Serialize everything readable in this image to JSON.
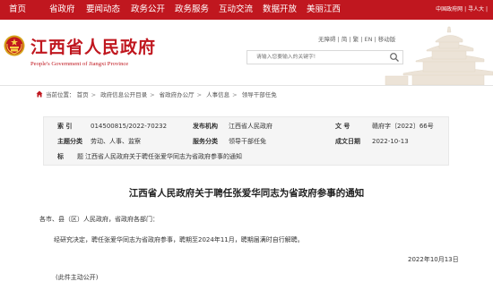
{
  "nav": {
    "items": [
      "首页",
      "省政府",
      "要闻动态",
      "政务公开",
      "政务服务",
      "互动交流",
      "数据开放",
      "美丽江西"
    ],
    "top_links": [
      "中国政府网",
      "|",
      "寻人大",
      "|"
    ]
  },
  "header": {
    "site_title": "江西省人民政府",
    "site_subtitle": "People's Government of Jiangxi Province",
    "util_links": [
      "无障碍",
      "简",
      "繁",
      "EN",
      "移动版"
    ],
    "search_placeholder": "请输入您要输入的关键字!"
  },
  "breadcrumb": [
    "首页",
    "政府信息公开目录",
    "省政府办公厅",
    "人事信息",
    "领导干部任免"
  ],
  "info": {
    "index_label": "索    引",
    "index_value": "014500815/2022-70232",
    "publisher_label": "发布机构",
    "publisher_value": "江西省人民政府",
    "docno_label": "文    号",
    "docno_value": "赣府字〔2022〕66号",
    "topic_label": "主题分类",
    "topic_value": "劳动、人事、监察",
    "service_label": "服务分类",
    "service_value": "领导干部任免",
    "date_label": "成文日期",
    "date_value": "2022-10-13",
    "title_label": "标",
    "title_mid": "题",
    "title_value": "江西省人民政府关于聘任张爱华同志为省政府参事的通知"
  },
  "document": {
    "title": "江西省人民政府关于聘任张爱华同志为省政府参事的通知",
    "salutation": "各市、县（区）人民政府，省政府各部门：",
    "body": "经研究决定，聘任张爱华同志为省政府参事，聘期至2024年11月，聘期届满时自行解聘。",
    "date": "2022年10月13日",
    "note": "(此件主动公开)"
  },
  "colors": {
    "brand_red": "#c0171f",
    "info_bg": "#f5f5f5"
  },
  "icons": [
    "emblem-icon",
    "search-icon",
    "home-icon"
  ]
}
